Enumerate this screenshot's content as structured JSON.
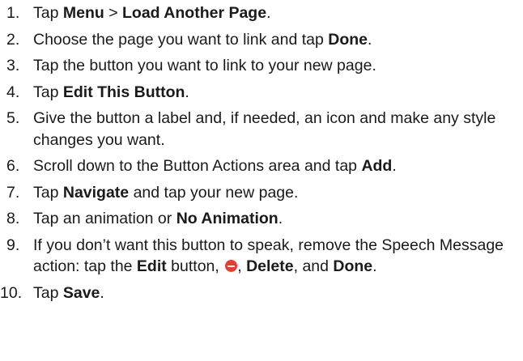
{
  "steps": [
    {
      "num": "1.",
      "parts": [
        "Tap ",
        "Menu",
        " > ",
        "Load Another Page",
        "."
      ]
    },
    {
      "num": "2.",
      "parts": [
        "Choose the page you want to link and tap ",
        "Done",
        "."
      ]
    },
    {
      "num": "3.",
      "text": "Tap the button you want to link to your new page."
    },
    {
      "num": "4.",
      "parts": [
        "Tap ",
        "Edit This Button",
        "."
      ]
    },
    {
      "num": "5.",
      "text": "Give the button a label and, if needed, an icon and make any style changes you want."
    },
    {
      "num": "6.",
      "parts": [
        "Scroll down to the Button Actions area and tap ",
        "Add",
        "."
      ]
    },
    {
      "num": "7.",
      "parts": [
        "Tap ",
        "Navigate",
        " and tap your new page."
      ]
    },
    {
      "num": "8.",
      "parts": [
        "Tap an animation or ",
        "No Animation",
        "."
      ]
    },
    {
      "num": "9.",
      "parts": [
        "If you don’t want this button to speak, remove the Speech Message action: tap the ",
        "Edit",
        " button, ",
        ", ",
        "Delete",
        ", and ",
        "Done",
        "."
      ],
      "icon": "minus-circle-icon"
    },
    {
      "num": "10.",
      "parts": [
        "Tap ",
        "Save",
        "."
      ]
    }
  ],
  "icon_color": "#ea3b2e"
}
